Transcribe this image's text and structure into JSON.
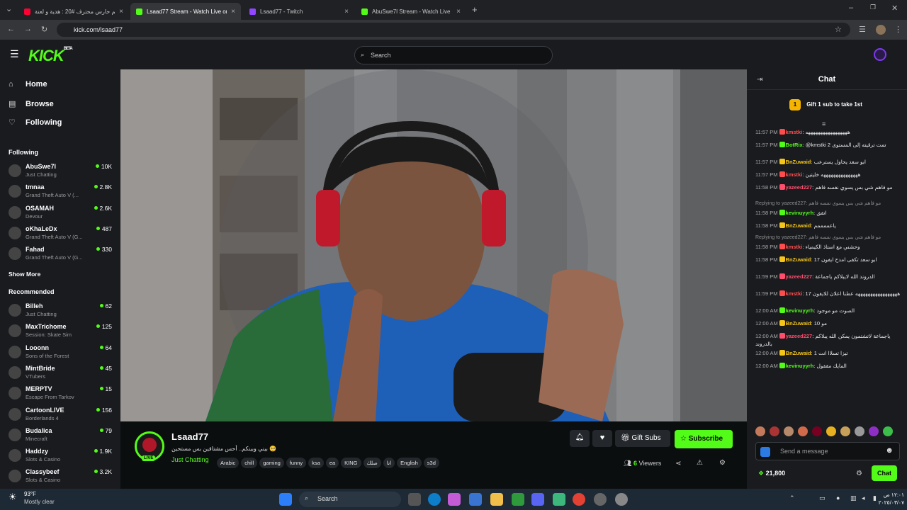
{
  "browser": {
    "tabs": [
      {
        "title": "حلم حارس محترف #20 : هدية و لعنة",
        "fav": "#ff0033"
      },
      {
        "title": "Lsaad77 Stream - Watch Live on Kick",
        "fav": "#53fc18"
      },
      {
        "title": "Lsaad77 - Twitch",
        "fav": "#9146ff"
      },
      {
        "title": "AbuSwe7l Stream - Watch Live on Kick",
        "fav": "#53fc18"
      }
    ],
    "url": "kick.com/lsaad77"
  },
  "header": {
    "logo": "KICK",
    "logo_badge": "BETA",
    "search_placeholder": "Search"
  },
  "sidebar": {
    "nav": [
      {
        "label": "Home",
        "icon": "home-icon"
      },
      {
        "label": "Browse",
        "icon": "browse-icon"
      },
      {
        "label": "Following",
        "icon": "heart-icon"
      }
    ],
    "following_title": "Following",
    "following": [
      {
        "name": "AbuSwe7l",
        "category": "Just Chatting",
        "viewers": "10K"
      },
      {
        "name": "tmnaa",
        "category": "Grand Theft Auto V (...",
        "viewers": "2.8K"
      },
      {
        "name": "OSAMAH",
        "category": "Devour",
        "viewers": "2.6K"
      },
      {
        "name": "oKhaLeDx",
        "category": "Grand Theft Auto V (G...",
        "viewers": "487"
      },
      {
        "name": "Fahad",
        "category": "Grand Theft Auto V (G...",
        "viewers": "330"
      }
    ],
    "show_more": "Show More",
    "recommended_title": "Recommended",
    "recommended": [
      {
        "name": "Billeh",
        "category": "Just Chatting",
        "viewers": "62"
      },
      {
        "name": "MaxTrichome",
        "category": "Session: Skate Sim",
        "viewers": "125"
      },
      {
        "name": "Looonn",
        "category": "Sons of the Forest",
        "viewers": "64"
      },
      {
        "name": "MintBride",
        "category": "VTubers",
        "viewers": "45"
      },
      {
        "name": "MERPTV",
        "category": "Escape From Tarkov",
        "viewers": "15"
      },
      {
        "name": "CartoonLIVE",
        "category": "Borderlands 4",
        "viewers": "156"
      },
      {
        "name": "Budalica",
        "category": "Minecraft",
        "viewers": "79"
      },
      {
        "name": "Haddzy",
        "category": "Slots & Casino",
        "viewers": "1.9K"
      },
      {
        "name": "Classybeef",
        "category": "Slots & Casino",
        "viewers": "3.2K"
      }
    ]
  },
  "stream": {
    "streamer": "Lsaad77",
    "live_badge": "LIVE",
    "title": "بيني وبينكم.. أحس مشتاقين بس مستحين 🥺",
    "category": "Just Chatting",
    "tags": [
      "Arabic",
      "chill",
      "gaming",
      "funny",
      "ksa",
      "ea",
      "KING",
      "صلك",
      "انا",
      "English",
      "s3d"
    ],
    "gift_subs": "Gift Subs",
    "subscribe": "Subscribe",
    "viewers_count": "6",
    "viewers_label": "Viewers"
  },
  "chat": {
    "title": "Chat",
    "gift_banner": "Gift 1 sub to take 1st",
    "gift_rank": "1",
    "messages": [
      {
        "time": "11:57 PM",
        "user": "kmstki",
        "color": "#ff4d4d",
        "text": "هههههههههههههههههه"
      },
      {
        "time": "11:57 PM",
        "user": "BotRix",
        "color": "#53fc18",
        "text": "@kmstki تمت ترقيته إلى المستوى 2"
      },
      {
        "time": "11:57 PM",
        "user": "BnZuwaid",
        "color": "#f5c518",
        "text": "ابو سعد يحاول يسترعب"
      },
      {
        "time": "11:57 PM",
        "user": "kmstki",
        "color": "#ff4d4d",
        "text": "هههههههههههههههه خليتين"
      },
      {
        "time": "11:58 PM",
        "user": "yazeed227",
        "color": "#ff4d6d",
        "text": "مو فاهم شي بس يسوي نفسه فاهم"
      },
      {
        "reply": "Replying to yazeed227: مو فاهم شي بس يسوي نفسه فاهم"
      },
      {
        "time": "11:58 PM",
        "user": "kevinuyyrh",
        "color": "#53fc18",
        "text": "اتفق"
      },
      {
        "time": "11:58 PM",
        "user": "BnZuwaid",
        "color": "#f5c518",
        "text": "ياعممممم"
      },
      {
        "reply": "Replying to yazeed227: مو فاهم شي بس يسوي نفسه فاهم"
      },
      {
        "time": "11:58 PM",
        "user": "kmstki",
        "color": "#ff4d4d",
        "text": "وحشني مع استاذ الكيمياء"
      },
      {
        "time": "11:58 PM",
        "user": "BnZuwaid",
        "color": "#f5c518",
        "text": "ابو سعد تكفى امدح ايفون 17"
      },
      {
        "time": "11:59 PM",
        "user": "yazeed227",
        "color": "#ff4d6d",
        "text": "الدروند الله لايبلاكم ياجماعة"
      },
      {
        "time": "11:59 PM",
        "user": "kmstki",
        "color": "#ff4d4d",
        "text": "هههههههههههههههههه عطنا اعلان للايفون 17"
      },
      {
        "time": "12:00 AM",
        "user": "kevinuyyrh",
        "color": "#53fc18",
        "text": "الصوت مو موجود"
      },
      {
        "time": "12:00 AM",
        "user": "BnZuwaid",
        "color": "#f5c518",
        "text": "10 مو"
      },
      {
        "time": "12:00 AM",
        "user": "yazeed227",
        "color": "#ff4d6d",
        "text": "ياجماعة لاتشتمون يمكن الله يبلاكم بالدروند"
      },
      {
        "time": "12:00 AM",
        "user": "BnZuwaid",
        "color": "#f5c518",
        "text": "تيزا تسلاا انت 1"
      },
      {
        "time": "12:00 AM",
        "user": "kevinuyyrh",
        "color": "#53fc18",
        "text": "المايك مقفول"
      }
    ],
    "input_placeholder": "Send a message",
    "points": "21,800",
    "chat_button": "Chat"
  },
  "taskbar": {
    "weather_temp": "93°F",
    "weather_desc": "Mostly clear",
    "search": "Search",
    "time": "١٢:٠١ ص",
    "date": "٢٠٢٥/٠٣/٠٧"
  }
}
